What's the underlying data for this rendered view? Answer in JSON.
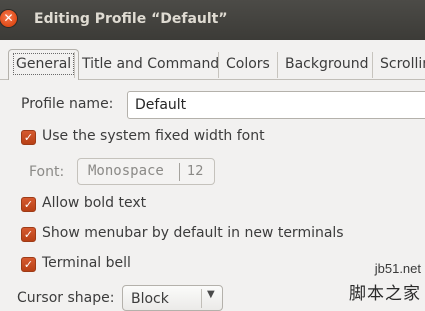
{
  "window": {
    "title": "Editing Profile “Default”"
  },
  "tabs": [
    {
      "label": "General",
      "active": true
    },
    {
      "label": "Title and Command"
    },
    {
      "label": "Colors"
    },
    {
      "label": "Background"
    },
    {
      "label": "Scrolling"
    }
  ],
  "general": {
    "profile_name_label": "Profile name:",
    "profile_name_value": "Default",
    "use_system_font_label": "Use the system fixed width font",
    "use_system_font_checked": true,
    "font_label": "Font:",
    "font_name": "Monospace",
    "font_size": "12",
    "allow_bold_label": "Allow bold text",
    "allow_bold_checked": true,
    "show_menubar_label": "Show menubar by default in new terminals",
    "show_menubar_checked": true,
    "terminal_bell_label": "Terminal bell",
    "terminal_bell_checked": true,
    "cursor_shape_label": "Cursor shape:",
    "cursor_shape_value": "Block"
  },
  "watermark": {
    "url": "jb51.net",
    "text": "脚本之家"
  },
  "colors": {
    "accent": "#d55a2f",
    "titlebar": "#3c3b37",
    "background": "#f2f1f0"
  }
}
